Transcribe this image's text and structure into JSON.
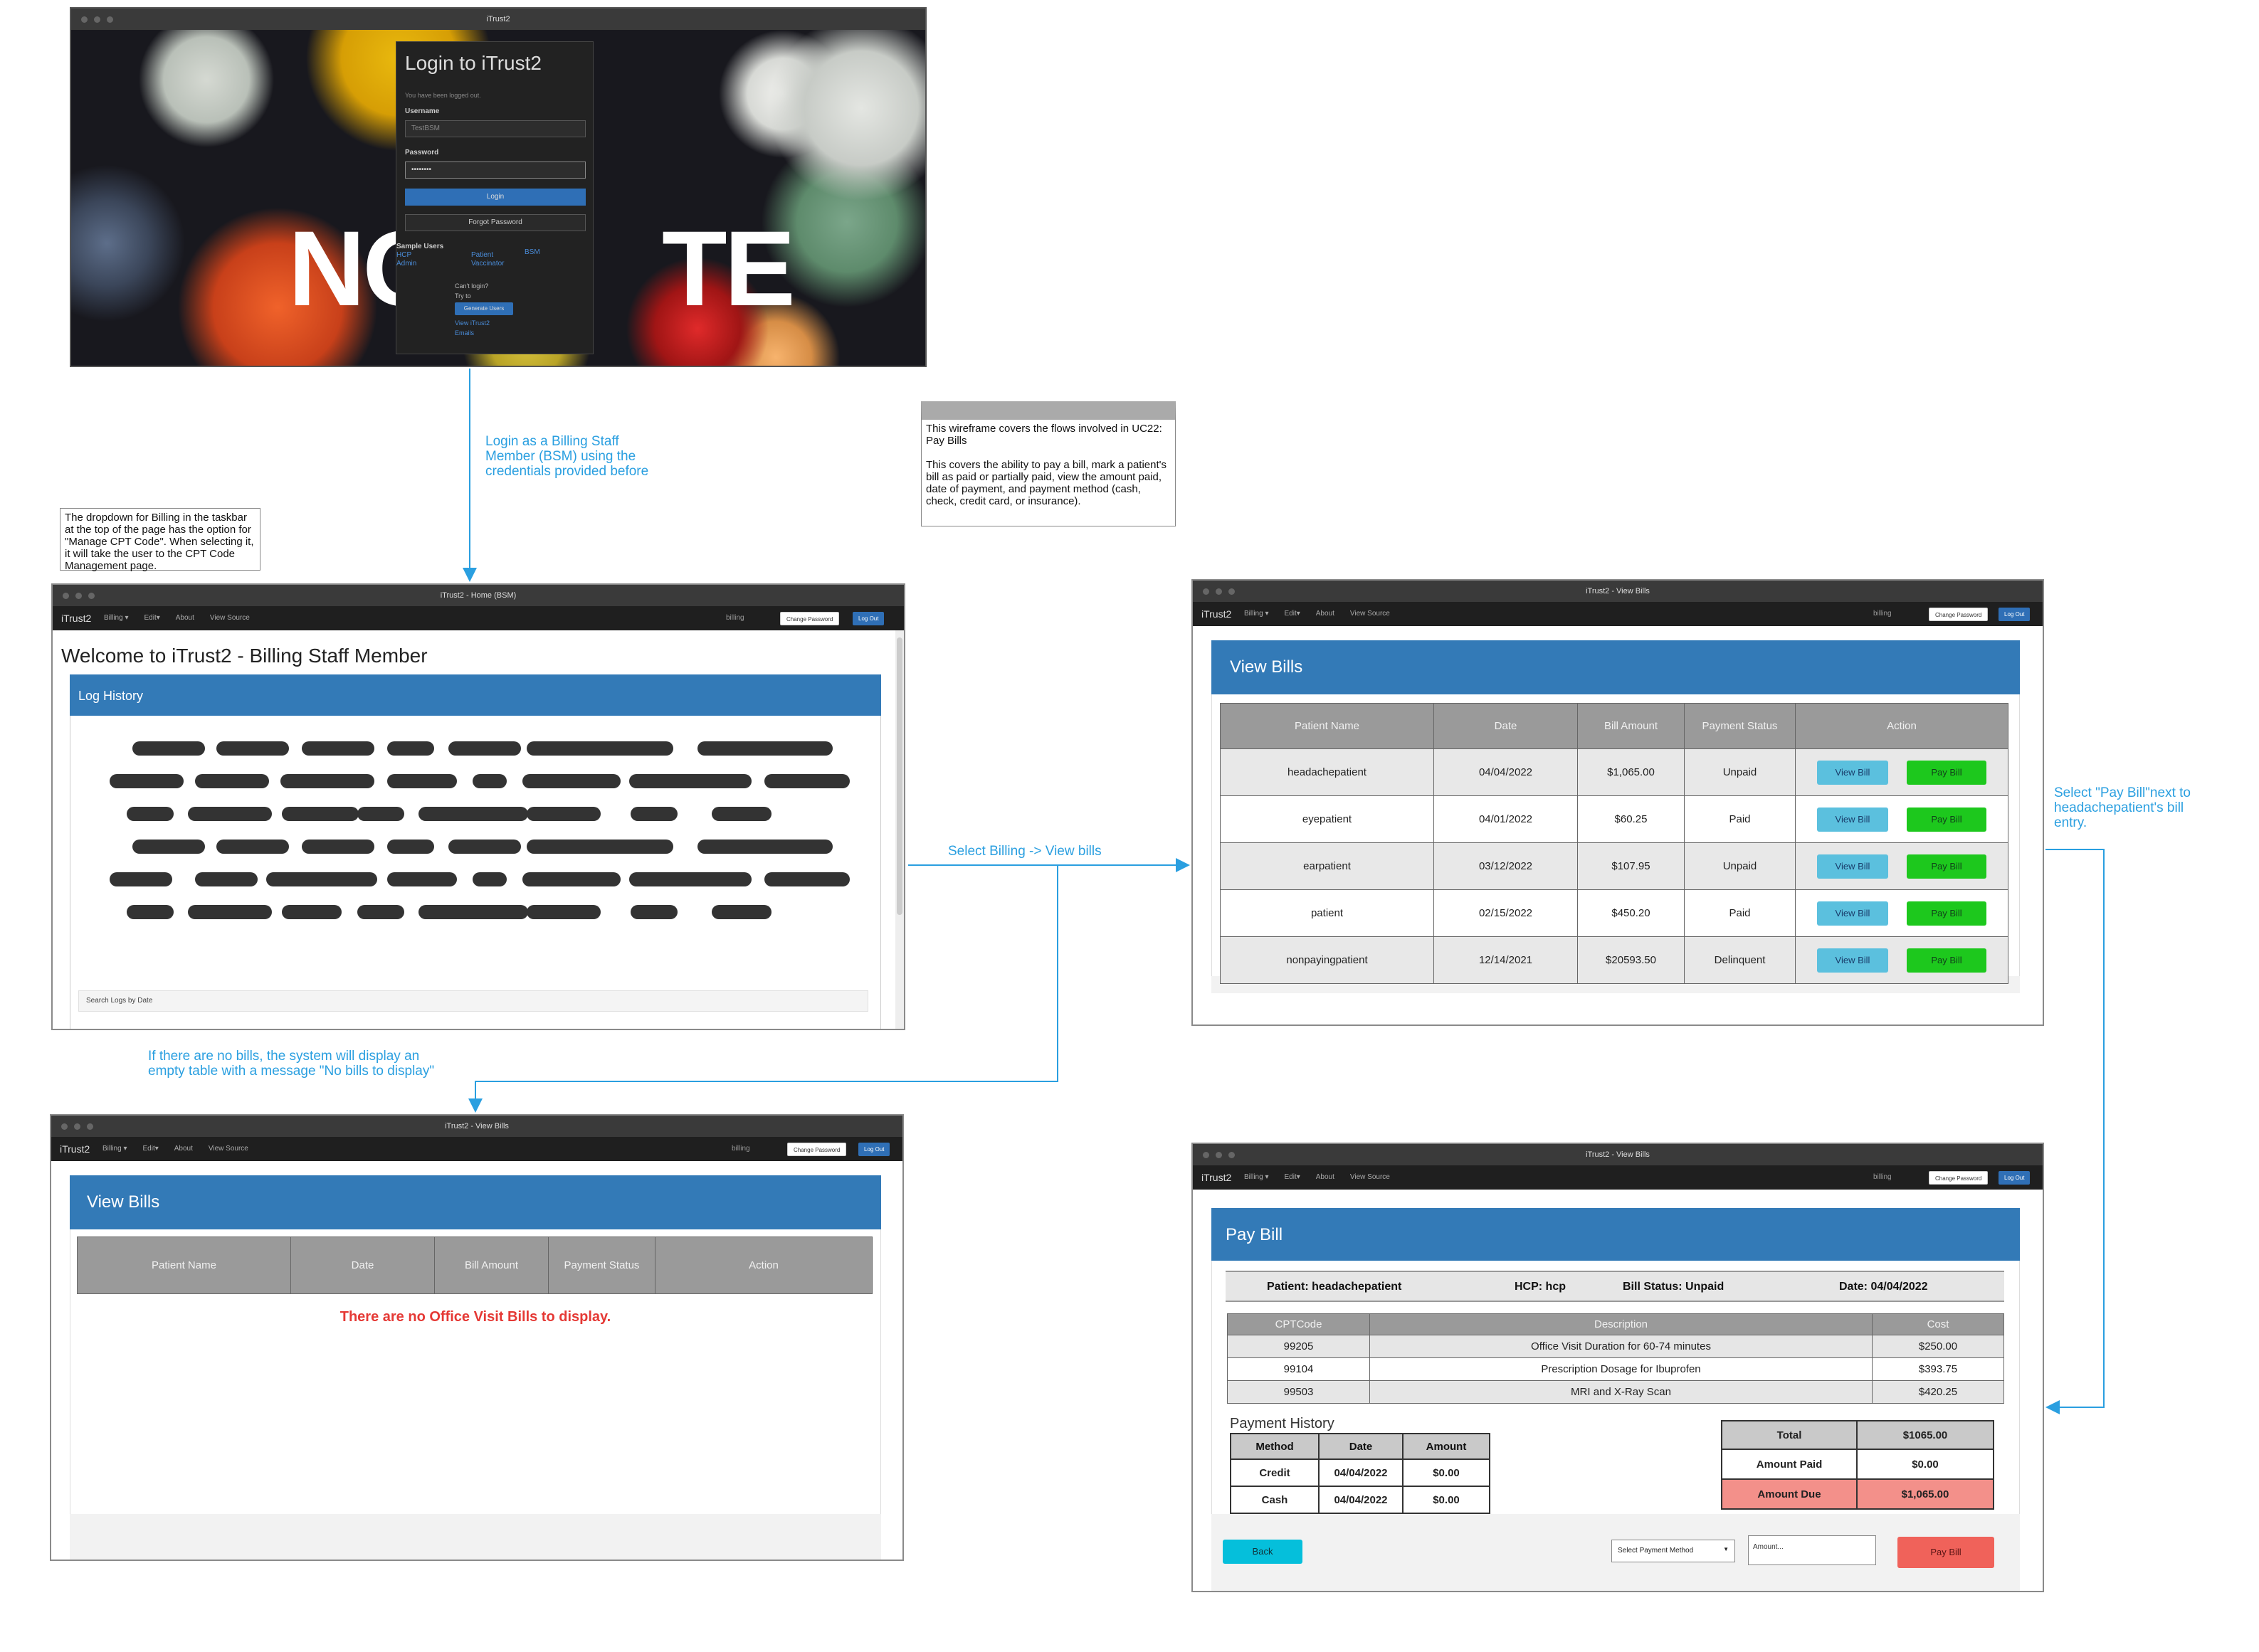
{
  "common": {
    "brand": "iTrust2",
    "menu": [
      "Billing ▾",
      "Edit▾",
      "About",
      "View Source"
    ],
    "user": "billing",
    "change_password": "Change Password",
    "logout": "Log Out"
  },
  "login_window": {
    "title": "iTrust2",
    "heading": "Login to iTrust2",
    "logged_out_msg": "You have been logged out.",
    "username_label": "Username",
    "username_value": "TestBSM",
    "password_label": "Password",
    "password_value": "••••••••",
    "login_button": "Login",
    "forgot_button": "Forgot Password",
    "sample_users_label": "Sample Users",
    "sample_users": [
      "HCP",
      "Admin",
      "Patient",
      "Vaccinator",
      "BSM"
    ],
    "cant_login": "Can't login?",
    "try_to": "Try to",
    "generate_users": "Generate Users",
    "view_itrust": "View iTrust2",
    "emails": "Emails",
    "bg_text_left": "NO",
    "bg_text_right": "TE"
  },
  "home_window": {
    "title": "iTrust2 - Home (BSM)",
    "welcome": "Welcome to iTrust2 - Billing Staff Member",
    "panel_title": "Log History",
    "search_label": "Search Logs by Date"
  },
  "empty_bills_window": {
    "title": "iTrust2 - View Bills",
    "panel_title": "View Bills",
    "columns": [
      "Patient Name",
      "Date",
      "Bill Amount",
      "Payment Status",
      "Action"
    ],
    "empty_message": "There are no Office Visit Bills to display."
  },
  "view_bills_window": {
    "title": "iTrust2 - View Bills",
    "panel_title": "View Bills",
    "columns": [
      "Patient Name",
      "Date",
      "Bill Amount",
      "Payment Status",
      "Action"
    ],
    "view_label": "View Bill",
    "pay_label": "Pay Bill",
    "rows": [
      {
        "name": "headachepatient",
        "date": "04/04/2022",
        "amount": "$1,065.00",
        "status": "Unpaid"
      },
      {
        "name": "eyepatient",
        "date": "04/01/2022",
        "amount": "$60.25",
        "status": "Paid"
      },
      {
        "name": "earpatient",
        "date": "03/12/2022",
        "amount": "$107.95",
        "status": "Unpaid"
      },
      {
        "name": "patient",
        "date": "02/15/2022",
        "amount": "$450.20",
        "status": "Paid"
      },
      {
        "name": "nonpayingpatient",
        "date": "12/14/2021",
        "amount": "$20593.50",
        "status": "Delinquent"
      }
    ]
  },
  "pay_bill_window": {
    "title": "iTrust2 - View Bills",
    "panel_title": "Pay Bill",
    "info": {
      "patient": "Patient: headachepatient",
      "hcp": "HCP: hcp",
      "status": "Bill Status: Unpaid",
      "date": "Date: 04/04/2022"
    },
    "cpt_columns": [
      "CPTCode",
      "Description",
      "Cost"
    ],
    "cpt_rows": [
      {
        "code": "99205",
        "desc": "Office Visit Duration for 60-74 minutes",
        "cost": "$250.00"
      },
      {
        "code": "99104",
        "desc": "Prescription Dosage for Ibuprofen",
        "cost": "$393.75"
      },
      {
        "code": "99503",
        "desc": "MRI and X-Ray Scan",
        "cost": "$420.25"
      }
    ],
    "payment_history_label": "Payment History",
    "history_columns": [
      "Method",
      "Date",
      "Amount"
    ],
    "history_rows": [
      {
        "method": "Credit",
        "date": "04/04/2022",
        "amount": "$0.00"
      },
      {
        "method": "Cash",
        "date": "04/04/2022",
        "amount": "$0.00"
      }
    ],
    "summary": {
      "total_label": "Total",
      "total_value": "$1065.00",
      "paid_label": "Amount Paid",
      "paid_value": "$0.00",
      "due_label": "Amount Due",
      "due_value": "$1,065.00"
    },
    "back_button": "Back",
    "method_select": "Select Payment Method",
    "amount_placeholder": "Amount...",
    "pay_button": "Pay Bill"
  },
  "notes": {
    "wireframe_note": "This wireframe covers the flows involved in UC22: Pay Bills\n\nThis covers the ability to  pay a bill, mark a patient's bill as paid or partially paid, view the amount paid, date of payment, and payment method (cash, check, credit card, or insurance).",
    "dropdown_note": "The dropdown for Billing in the taskbar at the top of the page has the option for \"Manage CPT Code\". When selecting it, it will take the user to the CPT Code Management page."
  },
  "annotations": {
    "login_flow": "Login as a Billing Staff Member (BSM) using the credentials provided before",
    "select_billing": "Select Billing -> View bills",
    "no_bills": "If there are no bills, the system will display an empty table with a message \"No bills to display\"",
    "select_pay": "Select \"Pay Bill\"next to headachepatient's bill entry."
  },
  "colors": {
    "panel_blue": "#337ab7",
    "annotation_blue": "#2a9fe0",
    "view_btn": "#5bc0de",
    "pay_btn_green": "#1dc81d",
    "pay_btn_red": "#f0625a",
    "amount_due_bg": "#f3908a",
    "empty_msg_red": "#e53935"
  }
}
